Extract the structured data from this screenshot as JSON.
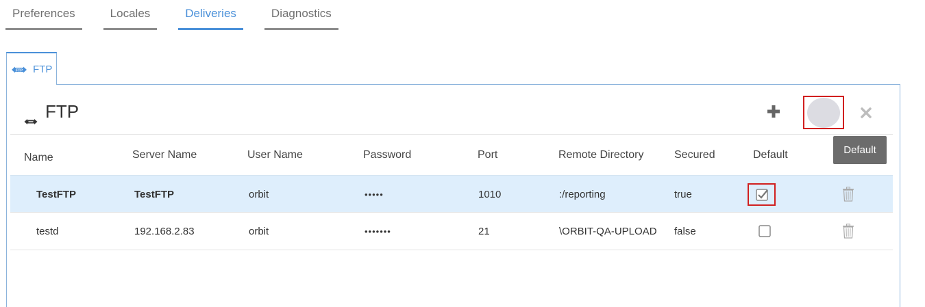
{
  "top_tabs": [
    {
      "label": "Preferences"
    },
    {
      "label": "Locales"
    },
    {
      "label": "Deliveries"
    },
    {
      "label": "Diagnostics"
    }
  ],
  "active_tab": "Deliveries",
  "sub_tab": {
    "label": "FTP",
    "icon": "ftp-icon"
  },
  "panel": {
    "title": "FTP",
    "title_icon": "ftp-arrow-icon",
    "tooltip": "Default",
    "actions": [
      "plus-icon",
      "circle-icon",
      "close-icon"
    ]
  },
  "table": {
    "headers": [
      "Name",
      "Server Name",
      "User Name",
      "Password",
      "Port",
      "Remote Directory",
      "Secured",
      "Default"
    ],
    "rows": [
      {
        "name": "TestFTP",
        "server": "TestFTP",
        "user": "orbit",
        "password": "•••••",
        "port": "1010",
        "remote_dir": ":/reporting",
        "secured": "true",
        "default": true
      },
      {
        "name": "testd",
        "server": "192.168.2.83",
        "user": "orbit",
        "password": "•••••••",
        "port": "21",
        "remote_dir": "\\ORBIT-QA-UPLOAD",
        "secured": "false",
        "default": false
      }
    ]
  },
  "colors": {
    "accent": "#4a90d9",
    "highlight": "#d11f1f",
    "selected_row": "#deeefc",
    "tooltip_bg": "#6c6c6c"
  }
}
